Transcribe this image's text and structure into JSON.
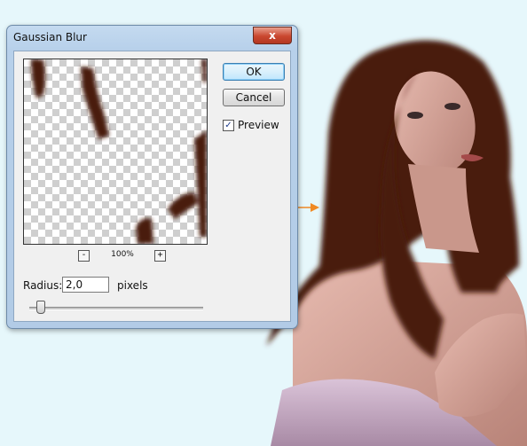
{
  "dialog": {
    "title": "Gaussian Blur",
    "close_label": "x",
    "ok_label": "OK",
    "cancel_label": "Cancel",
    "preview_label": "Preview",
    "preview_checked": true,
    "zoom_out_label": "-",
    "zoom_in_label": "+",
    "zoom_value": "100%",
    "radius_label": "Radius:",
    "radius_value": "2,0",
    "radius_unit": "pixels",
    "slider_level": 0.06
  },
  "colors": {
    "hair": "#4a1b10",
    "skin": "#d8a79a",
    "fabric": "#c8a7c3",
    "arrow": "#f08a24",
    "background": "#e6f7fb"
  }
}
